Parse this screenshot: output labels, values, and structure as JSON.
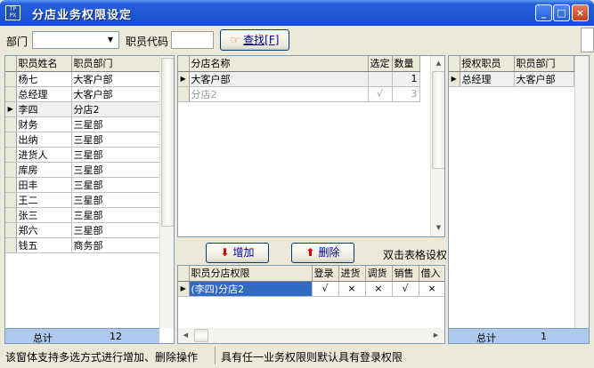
{
  "window": {
    "title": "分店业务权限设定",
    "icon_text": "TP\nPX"
  },
  "toolbar": {
    "dept_label": "部门",
    "dept_value": "",
    "code_label": "职员代码",
    "code_value": "",
    "find_label": "查找[F]"
  },
  "employees": {
    "headers": [
      "职员姓名",
      "职员部门"
    ],
    "rows": [
      {
        "name": "杨七",
        "dept": "大客户部"
      },
      {
        "name": "总经理",
        "dept": "大客户部"
      },
      {
        "name": "李四",
        "dept": "分店2"
      },
      {
        "name": "财务",
        "dept": "三星部"
      },
      {
        "name": "出纳",
        "dept": "三星部"
      },
      {
        "name": "进货人",
        "dept": "三星部"
      },
      {
        "name": "库房",
        "dept": "三星部"
      },
      {
        "name": "田丰",
        "dept": "三星部"
      },
      {
        "name": "王二",
        "dept": "三星部"
      },
      {
        "name": "张三",
        "dept": "三星部"
      },
      {
        "name": "郑六",
        "dept": "三星部"
      },
      {
        "name": "钱五",
        "dept": "商务部"
      }
    ],
    "footer_label": "总计",
    "footer_count": "12"
  },
  "branches": {
    "headers": [
      "分店名称",
      "选定",
      "数量"
    ],
    "rows": [
      {
        "name": "大客户部",
        "sel": "",
        "qty": "1"
      },
      {
        "name": "分店2",
        "sel": "√",
        "qty": "3"
      }
    ]
  },
  "actions": {
    "add_label": "增加",
    "delete_label": "删除",
    "hint": "双击表格设权"
  },
  "perms": {
    "headers": [
      "职员分店权限",
      "登录",
      "进货",
      "调货",
      "销售",
      "借入"
    ],
    "rows": [
      {
        "name": "(李四)分店2",
        "v": [
          "√",
          "×",
          "×",
          "√",
          "×"
        ]
      }
    ]
  },
  "authorized": {
    "headers": [
      "授权职员",
      "职员部门"
    ],
    "rows": [
      {
        "name": "总经理",
        "dept": "大客户部"
      }
    ],
    "footer_label": "总计",
    "footer_count": "1"
  },
  "status": {
    "left": "该窗体支持多选方式进行增加、删除操作",
    "right": "具有任一业务权限则默认具有登录权限"
  }
}
